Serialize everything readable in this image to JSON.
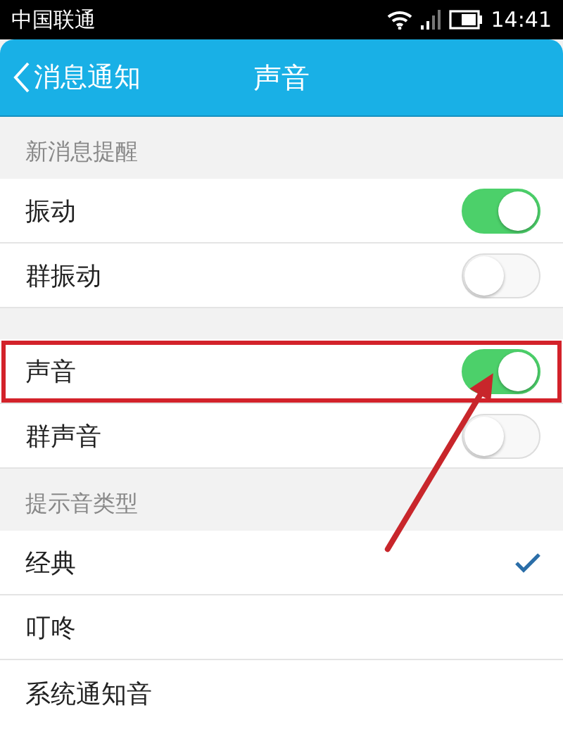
{
  "status_bar": {
    "carrier": "中国联通",
    "time": "14:41"
  },
  "header": {
    "back_label": "消息通知",
    "title": "声音"
  },
  "sections": [
    {
      "title": "新消息提醒",
      "rows": [
        {
          "kind": "toggle",
          "label": "振动",
          "on": true,
          "highlighted": false
        },
        {
          "kind": "toggle",
          "label": "群振动",
          "on": false,
          "highlighted": false
        }
      ]
    },
    {
      "rows": [
        {
          "kind": "toggle",
          "label": "声音",
          "on": true,
          "highlighted": true
        },
        {
          "kind": "toggle",
          "label": "群声音",
          "on": false,
          "highlighted": false
        }
      ]
    },
    {
      "title": "提示音类型",
      "rows": [
        {
          "kind": "check",
          "label": "经典",
          "selected": true,
          "highlighted": false
        },
        {
          "kind": "check",
          "label": "叮咚",
          "selected": false,
          "highlighted": false
        },
        {
          "kind": "check",
          "label": "系统通知音",
          "selected": false,
          "highlighted": false
        }
      ]
    }
  ]
}
